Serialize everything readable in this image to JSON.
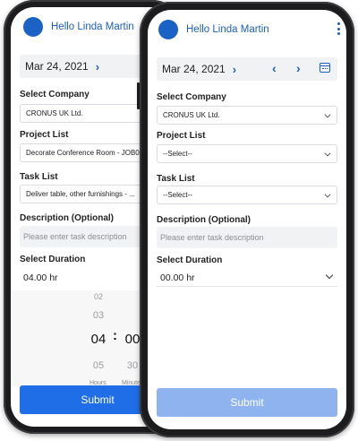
{
  "back_screen": {
    "greeting": "Hello Linda Martin",
    "date": "Mar 24, 2021",
    "company_label": "Select Company",
    "company_value": "CRONUS UK Ltd.",
    "project_label": "Project List",
    "project_value": "Decorate Conference Room - JOB00",
    "task_label": "Task List",
    "task_value": "Deliver table, other furnishings - ...",
    "description_label": "Description (Optional)",
    "description_placeholder": "Please enter task description",
    "duration_label": "Select Duration",
    "duration_value": "04.00 hr",
    "picker": {
      "hours": [
        "02",
        "03",
        "04",
        "05"
      ],
      "minutes": [
        "00",
        "30"
      ],
      "hours_label": "Hours",
      "minutes_label": "Minutes"
    },
    "submit_label": "Submit"
  },
  "front_screen": {
    "greeting": "Hello Linda Martin",
    "date": "Mar 24, 2021",
    "company_label": "Select Company",
    "company_value": "CRONUS UK Ltd.",
    "project_label": "Project List",
    "project_value": "--Select--",
    "task_label": "Task List",
    "task_value": "--Select--",
    "description_label": "Description (Optional)",
    "description_placeholder": "Please enter task description",
    "duration_label": "Select Duration",
    "duration_value": "00.00 hr",
    "submit_label": "Submit"
  },
  "colors": {
    "accent": "#1b5fbf",
    "submit_active": "#1f6ee8",
    "submit_disabled": "#8fb3ef",
    "field_bg": "#f1f2f4"
  },
  "icons": [
    "avatar-circle",
    "chevron-right-icon",
    "chevron-left-icon",
    "calendar-icon",
    "kebab-menu-icon",
    "dropdown-caret-icon"
  ]
}
